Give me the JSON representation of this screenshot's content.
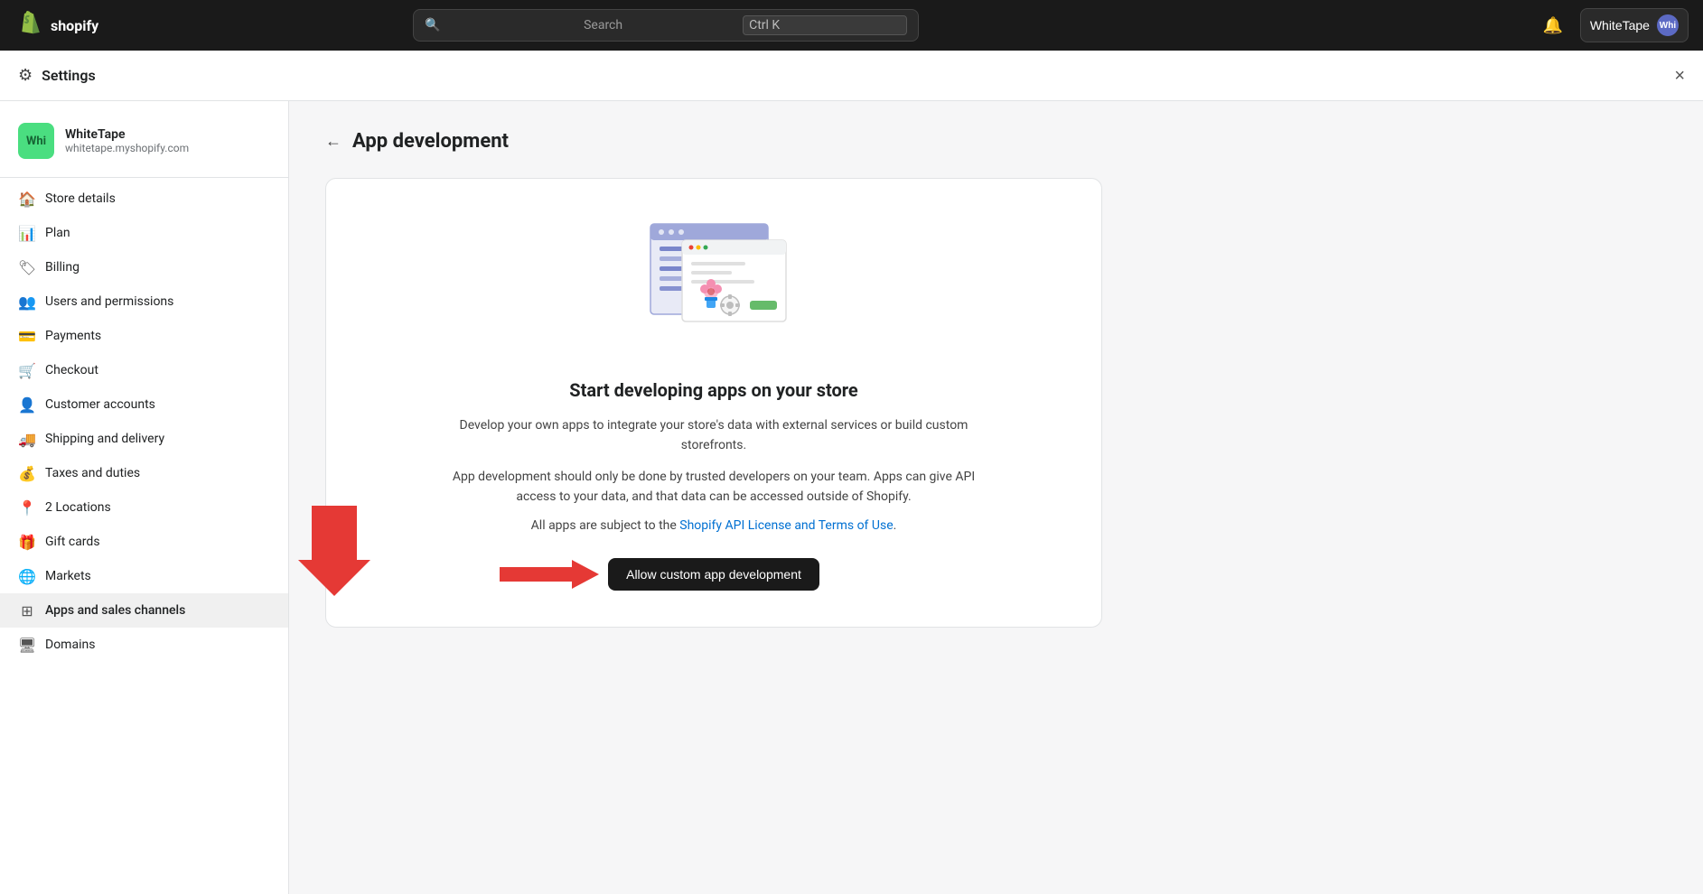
{
  "topbar": {
    "logo_text": "shopify",
    "search_placeholder": "Search",
    "search_shortcut": "Ctrl K",
    "store_name": "WhiteTape",
    "avatar_initials": "Whi"
  },
  "settings": {
    "title": "Settings",
    "close_label": "×"
  },
  "store": {
    "name": "WhiteTape",
    "url": "whitetape.myshopify.com",
    "avatar_initials": "Whi"
  },
  "sidebar": {
    "items": [
      {
        "id": "store-details",
        "label": "Store details",
        "icon": "🏠"
      },
      {
        "id": "plan",
        "label": "Plan",
        "icon": "📊"
      },
      {
        "id": "billing",
        "label": "Billing",
        "icon": "🏷"
      },
      {
        "id": "users-permissions",
        "label": "Users and permissions",
        "icon": "👥"
      },
      {
        "id": "payments",
        "label": "Payments",
        "icon": "💳"
      },
      {
        "id": "checkout",
        "label": "Checkout",
        "icon": "🛒"
      },
      {
        "id": "customer-accounts",
        "label": "Customer accounts",
        "icon": "👤"
      },
      {
        "id": "shipping-delivery",
        "label": "Shipping and delivery",
        "icon": "🚚"
      },
      {
        "id": "taxes-duties",
        "label": "Taxes and duties",
        "icon": "💰"
      },
      {
        "id": "locations",
        "label": "2 Locations",
        "icon": "📍"
      },
      {
        "id": "gift-cards",
        "label": "Gift cards",
        "icon": "🎁"
      },
      {
        "id": "markets",
        "label": "Markets",
        "icon": "🌐"
      },
      {
        "id": "apps-sales-channels",
        "label": "Apps and sales channels",
        "icon": "🔲"
      },
      {
        "id": "domains",
        "label": "Domains",
        "icon": "🖥"
      }
    ]
  },
  "page": {
    "title": "App development",
    "back_label": "←"
  },
  "card": {
    "title": "Start developing apps on your store",
    "description": "Develop your own apps to integrate your store's data with external services or build custom storefronts.",
    "note": "App development should only be done by trusted developers on your team. Apps can give API access to your data, and that data can be accessed outside of Shopify.",
    "terms_prefix": "All apps are subject to the ",
    "terms_link_text": "Shopify API License and Terms of Use",
    "terms_suffix": ".",
    "allow_button": "Allow custom app development"
  }
}
